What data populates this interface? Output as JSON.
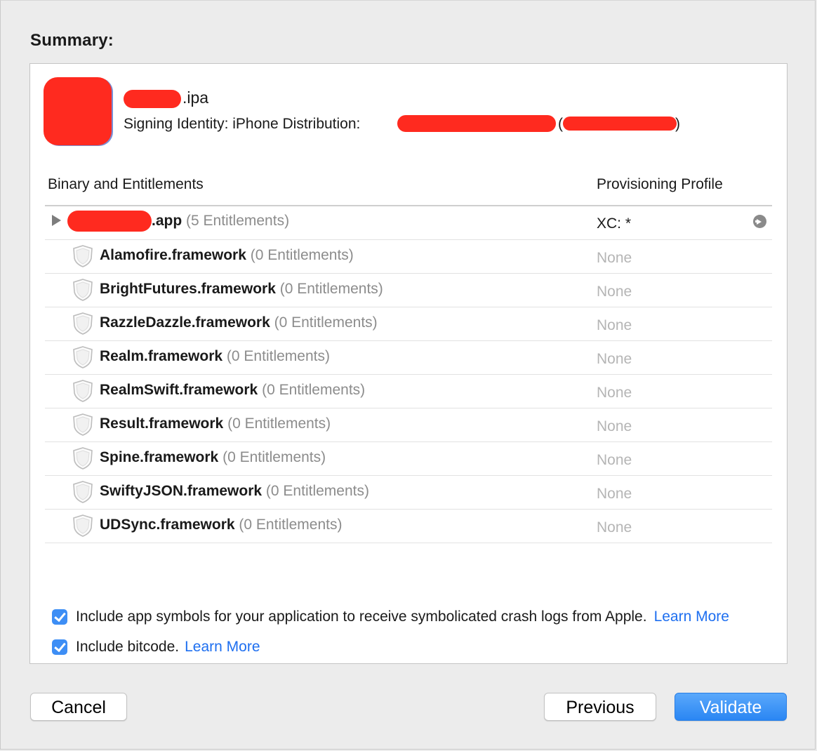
{
  "summary_title": "Summary:",
  "app": {
    "ipa_suffix": ".ipa",
    "signing_label": "Signing Identity: iPhone Distribution:",
    "signing_paren_open": "(",
    "signing_paren_close": ")"
  },
  "table": {
    "col_binary": "Binary and Entitlements",
    "col_profile": "Provisioning Profile",
    "main_row": {
      "name_suffix": ".app",
      "entitlements": "(5 Entitlements)",
      "profile": "XC: *"
    },
    "rows": [
      {
        "name": "Alamofire.framework",
        "entitlements": "(0 Entitlements)",
        "profile": "None"
      },
      {
        "name": "BrightFutures.framework",
        "entitlements": "(0 Entitlements)",
        "profile": "None"
      },
      {
        "name": "RazzleDazzle.framework",
        "entitlements": "(0 Entitlements)",
        "profile": "None"
      },
      {
        "name": "Realm.framework",
        "entitlements": "(0 Entitlements)",
        "profile": "None"
      },
      {
        "name": "RealmSwift.framework",
        "entitlements": "(0 Entitlements)",
        "profile": "None"
      },
      {
        "name": "Result.framework",
        "entitlements": "(0 Entitlements)",
        "profile": "None"
      },
      {
        "name": "Spine.framework",
        "entitlements": "(0 Entitlements)",
        "profile": "None"
      },
      {
        "name": "SwiftyJSON.framework",
        "entitlements": "(0 Entitlements)",
        "profile": "None"
      },
      {
        "name": "UDSync.framework",
        "entitlements": "(0 Entitlements)",
        "profile": "None"
      }
    ]
  },
  "options": {
    "symbols_label": "Include app symbols for your application to receive symbolicated crash logs from Apple.",
    "symbols_checked": true,
    "bitcode_label": "Include bitcode.",
    "bitcode_checked": true,
    "learn_more": "Learn More"
  },
  "buttons": {
    "cancel": "Cancel",
    "previous": "Previous",
    "validate": "Validate"
  },
  "colors": {
    "accent": "#3d8ef5",
    "link": "#1e6ff0",
    "redaction": "#ff2a1f"
  }
}
